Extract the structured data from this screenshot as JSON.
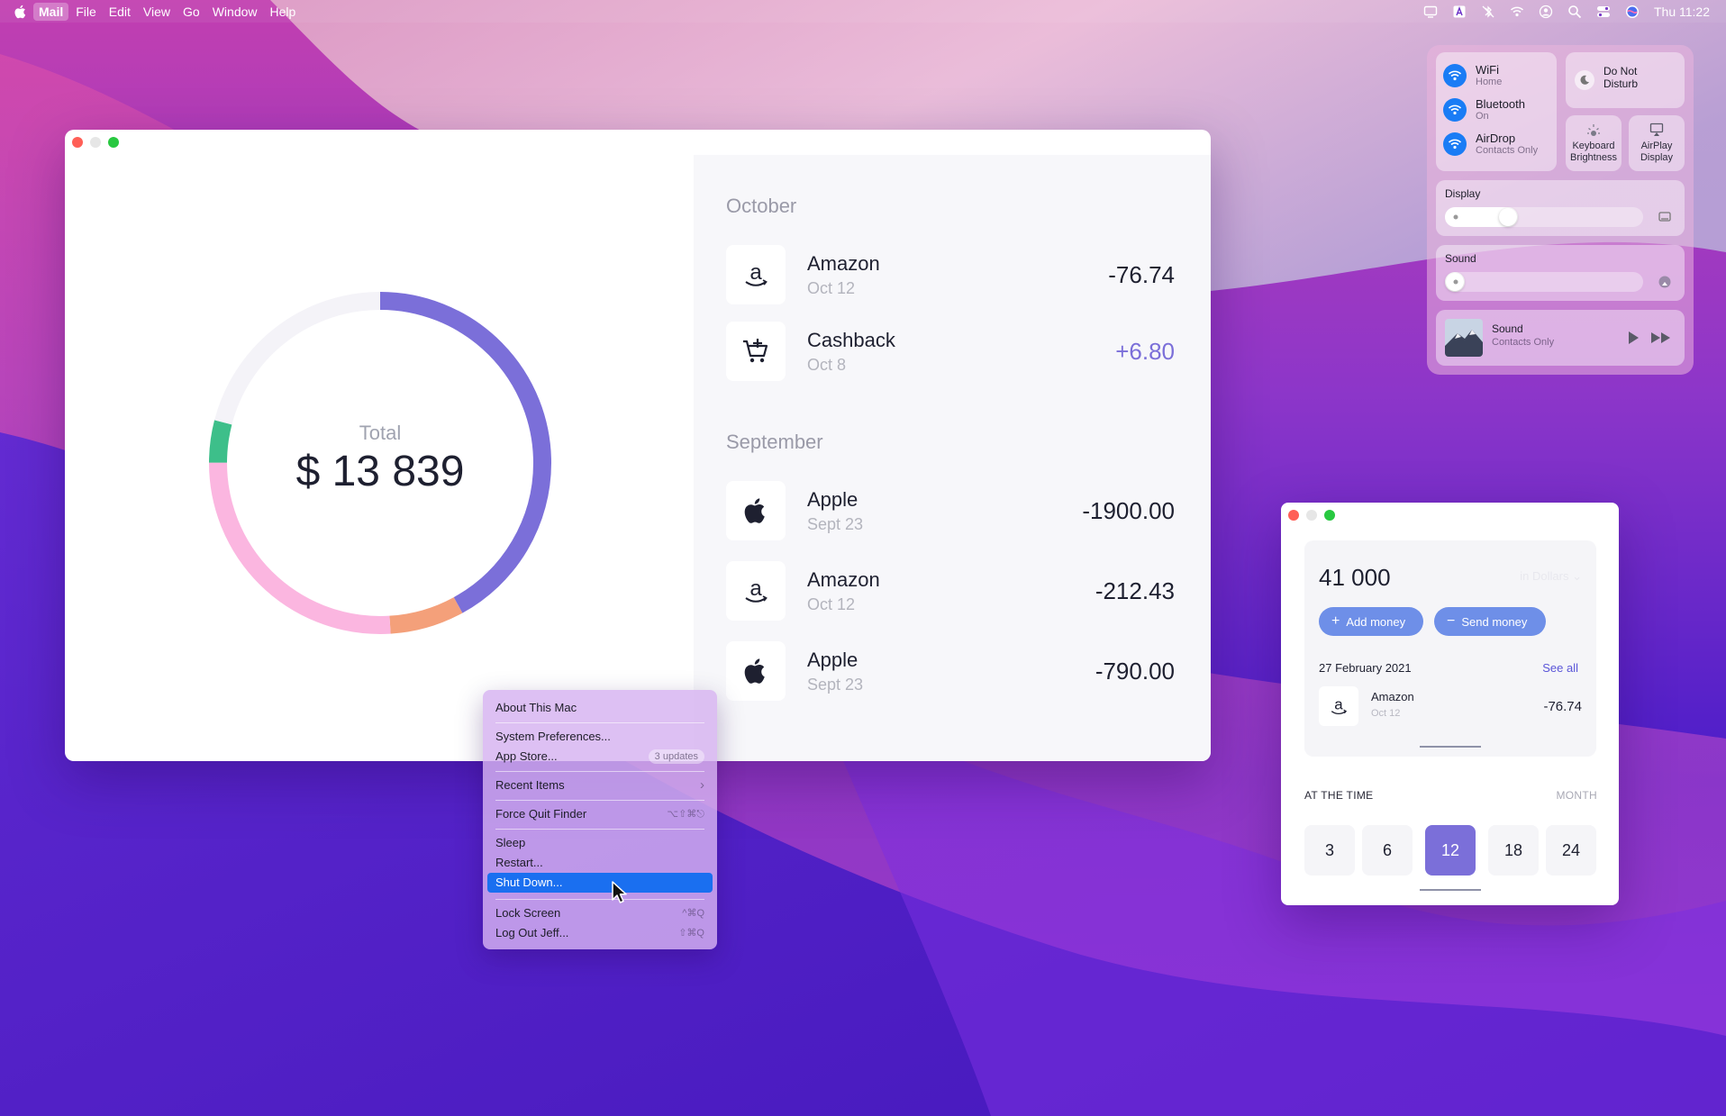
{
  "menubar": {
    "app_name": "Mail",
    "items": [
      "File",
      "Edit",
      "View",
      "Go",
      "Window",
      "Help"
    ],
    "clock": "Thu 11:22"
  },
  "main": {
    "chart_label": "Total",
    "chart_total": "$ 13 839",
    "groups": [
      {
        "month": "October",
        "transactions": [
          {
            "name": "Amazon",
            "date": "Oct 12",
            "amount": "-76.74",
            "icon": "amazon-icon",
            "positive": false
          },
          {
            "name": "Cashback",
            "date": "Oct 8",
            "amount": "+6.80",
            "icon": "cart-icon",
            "positive": true
          }
        ]
      },
      {
        "month": "September",
        "transactions": [
          {
            "name": "Apple",
            "date": "Sept 23",
            "amount": "-1900.00",
            "icon": "apple-icon",
            "positive": false
          },
          {
            "name": "Amazon",
            "date": "Oct 12",
            "amount": "-212.43",
            "icon": "amazon-icon",
            "positive": false
          },
          {
            "name": "Apple",
            "date": "Sept 23",
            "amount": "-790.00",
            "icon": "apple-icon",
            "positive": false
          }
        ]
      }
    ]
  },
  "chart_data": {
    "type": "pie",
    "segments": [
      {
        "color": "#7b6fd9",
        "value": 0.42
      },
      {
        "color": "#f4a07a",
        "value": 0.07
      },
      {
        "color": "#fbb6e0",
        "value": 0.26
      },
      {
        "color": "#3dbf8a",
        "value": 0.04
      },
      {
        "color": "#f4f3f8",
        "value": 0.21
      }
    ]
  },
  "apple_menu": {
    "items": [
      {
        "label": "About This Mac",
        "shortcut": ""
      },
      {
        "label": "System Preferences...",
        "shortcut": ""
      },
      {
        "label": "App Store...",
        "badge": "3 updates"
      },
      {
        "label": "Recent Items",
        "shortcut": "›"
      },
      {
        "label": "Force Quit Finder",
        "shortcut": "⌥⇧⌘⎋"
      },
      {
        "label": "Sleep",
        "shortcut": ""
      },
      {
        "label": "Restart...",
        "shortcut": ""
      },
      {
        "label": "Shut Down...",
        "shortcut": ""
      },
      {
        "label": "Lock Screen",
        "shortcut": "^⌘Q"
      },
      {
        "label": "Log Out Jeff...",
        "shortcut": "⇧⌘Q"
      }
    ]
  },
  "control_center": {
    "wifi": {
      "title": "WiFi",
      "sub": "Home"
    },
    "bluetooth": {
      "title": "Bluetooth",
      "sub": "On"
    },
    "airdrop": {
      "title": "AirDrop",
      "sub": "Contacts Only"
    },
    "dnd": "Do Not\nDisturb",
    "keyboard_brightness": "Keyboard\nBrightness",
    "airplay": "AirPlay\nDisplay",
    "display": {
      "title": "Display",
      "level": 0.37
    },
    "sound": {
      "title": "Sound",
      "level": 0.0
    },
    "now_playing": {
      "title": "Sound",
      "sub": "Contacts Only"
    }
  },
  "wallet": {
    "balance": "41 000",
    "currency": "in Dollars",
    "add_money": "Add money",
    "send_money": "Send money",
    "date": "27 February 2021",
    "see_all": "See all",
    "tx": {
      "name": "Amazon",
      "date": "Oct 12",
      "amount": "-76.74"
    },
    "at_the_time": "AT THE TIME",
    "month": "MONTH",
    "periods": [
      "3",
      "6",
      "12",
      "18",
      "24"
    ],
    "selected_period": "12"
  }
}
